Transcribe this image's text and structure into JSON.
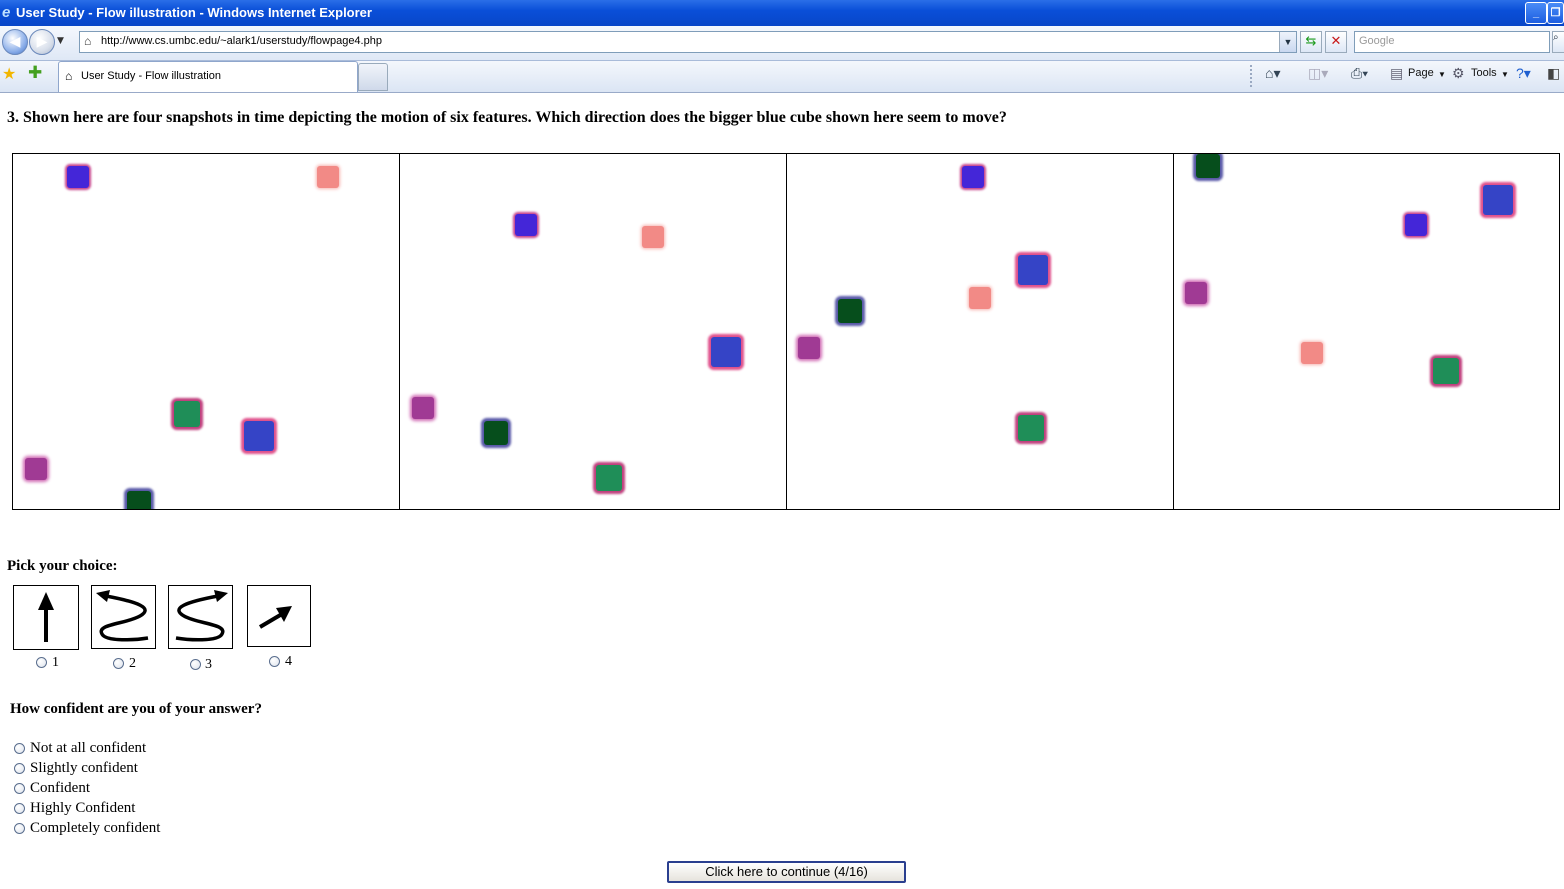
{
  "window": {
    "title": "User Study - Flow illustration - Windows Internet Explorer",
    "icon": "ie-icon"
  },
  "address_bar": {
    "url": "http://www.cs.umbc.edu/~alark1/userstudy/flowpage4.php",
    "search_placeholder": "Google"
  },
  "tabs": [
    {
      "label": "User Study - Flow illustration"
    }
  ],
  "command_bar": {
    "page_label": "Page",
    "tools_label": "Tools"
  },
  "question": {
    "text": "3. Shown here are four snapshots in time depicting the motion of six features. Which direction does the bigger blue cube shown here seem to move?"
  },
  "feature_colors": {
    "pink": "#f28a86",
    "blue": "#4426d8",
    "big_blue": "#3544c6",
    "purple": "#a03a94",
    "teal": "#1f8e58",
    "dark_green": "#064e1c"
  },
  "pick": {
    "heading": "Pick your choice:",
    "options": [
      {
        "number": "1",
        "icon": "arrow-up-icon"
      },
      {
        "number": "2",
        "icon": "zigzag-left-icon"
      },
      {
        "number": "3",
        "icon": "zigzag-right-icon"
      },
      {
        "number": "4",
        "icon": "arrow-diagonal-icon"
      }
    ]
  },
  "confidence": {
    "heading": "How confident are you of your answer?",
    "options": [
      "Not at all confident",
      "Slightly confident",
      "Confident",
      "Highly Confident",
      "Completely confident"
    ]
  },
  "continue_button": {
    "label": "Click here to continue (4/16)"
  }
}
